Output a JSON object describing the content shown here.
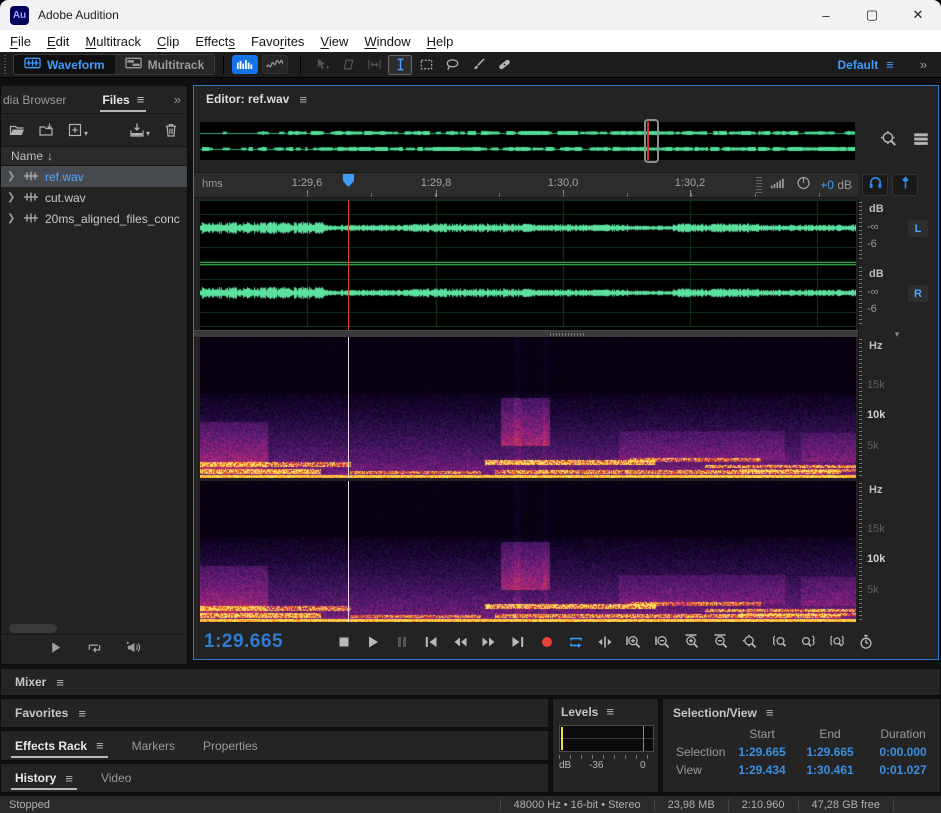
{
  "window": {
    "title": "Adobe Audition",
    "logo": "Au",
    "controls": {
      "minimize": "–",
      "maximize": "▢",
      "close": "✕"
    }
  },
  "menu_bar": {
    "items": [
      {
        "label": "File",
        "accel": 0
      },
      {
        "label": "Edit",
        "accel": 0
      },
      {
        "label": "Multitrack",
        "accel": 0
      },
      {
        "label": "Clip",
        "accel": 0
      },
      {
        "label": "Effects",
        "accel": 6
      },
      {
        "label": "Favorites",
        "accel": 4
      },
      {
        "label": "View",
        "accel": 0
      },
      {
        "label": "Window",
        "accel": 0
      },
      {
        "label": "Help",
        "accel": 0
      }
    ]
  },
  "toolbar": {
    "waveform_label": "Waveform",
    "multitrack_label": "Multitrack",
    "view_buttons": [
      {
        "name": "waveform-view",
        "active": true
      },
      {
        "name": "spectral-frequency-view",
        "active": false
      }
    ],
    "tools": [
      {
        "name": "move-tool",
        "state": "disabled"
      },
      {
        "name": "slip-tool",
        "state": "disabled"
      },
      {
        "name": "time-selection-tool",
        "state": "disabled"
      },
      {
        "name": "ibeam-tool",
        "state": "active"
      },
      {
        "name": "marquee-selection-tool",
        "state": "normal"
      },
      {
        "name": "lasso-selection-tool",
        "state": "normal"
      },
      {
        "name": "paintbrush-selection-tool",
        "state": "normal"
      },
      {
        "name": "spot-healing-brush-tool",
        "state": "normal"
      }
    ],
    "workspace_label": "Default",
    "overflow_chevron": "»"
  },
  "files_panel": {
    "tab_media_browser": "dia Browser",
    "tab_files": "Files",
    "overflow_chevron": "»",
    "toolbar_icons": [
      {
        "name": "open-file",
        "caret": false
      },
      {
        "name": "import-file",
        "caret": false
      },
      {
        "name": "new-content",
        "caret": true
      },
      {
        "name": "media-import",
        "caret": true
      },
      {
        "name": "delete",
        "caret": false
      }
    ],
    "column_header": "Name",
    "sort_arrow": "↓",
    "rows": [
      {
        "name": "ref.wav",
        "selected": true
      },
      {
        "name": "cut.wav",
        "selected": false
      },
      {
        "name": "20ms_aligned_files_conc",
        "selected": false
      }
    ],
    "preview_buttons": [
      {
        "name": "preview-play"
      },
      {
        "name": "preview-loop"
      },
      {
        "name": "preview-autoplay"
      }
    ]
  },
  "editor": {
    "title": "Editor: ref.wav",
    "ruler": {
      "unit": "hms",
      "ticks": [
        "1:29,6",
        "1:29,8",
        "1:30,0",
        "1:30,2"
      ],
      "gain_value": "+0",
      "gain_unit": "dB"
    },
    "waveform_scale": {
      "unit": "dB",
      "minus_inf": "-∞",
      "minus_six": "-6",
      "left_button": "L",
      "right_button": "R"
    },
    "spectral_scale": {
      "unit": "Hz",
      "tick_15k": "15k",
      "tick_10k": "10k",
      "tick_5k": "5k"
    },
    "collapse_arrow": "▾",
    "transport": {
      "time": "1:29.665",
      "buttons": [
        {
          "name": "stop",
          "state": "normal"
        },
        {
          "name": "play",
          "state": "normal"
        },
        {
          "name": "pause",
          "state": "disabled"
        },
        {
          "name": "skip-to-start",
          "state": "normal"
        },
        {
          "name": "rewind",
          "state": "normal"
        },
        {
          "name": "fast-forward",
          "state": "normal"
        },
        {
          "name": "skip-to-end",
          "state": "normal"
        },
        {
          "name": "record",
          "state": "record"
        },
        {
          "name": "loop-playback",
          "state": "blue"
        },
        {
          "name": "skip-selection",
          "state": "normal"
        },
        {
          "name": "zoom-in-amplitude",
          "state": "normal"
        },
        {
          "name": "zoom-out-amplitude",
          "state": "normal"
        },
        {
          "name": "zoom-in-time",
          "state": "normal"
        },
        {
          "name": "zoom-out-time",
          "state": "normal"
        },
        {
          "name": "zoom-reset",
          "state": "normal"
        },
        {
          "name": "zoom-to-in-point",
          "state": "normal"
        },
        {
          "name": "zoom-to-out-point",
          "state": "normal"
        },
        {
          "name": "zoom-to-selection",
          "state": "normal"
        },
        {
          "name": "timer-record",
          "state": "normal"
        }
      ]
    }
  },
  "mixer_panel": {
    "title": "Mixer"
  },
  "favorites_panel": {
    "title": "Favorites"
  },
  "effects_tabs": [
    {
      "label": "Effects Rack",
      "active": true
    },
    {
      "label": "Markers",
      "active": false
    },
    {
      "label": "Properties",
      "active": false
    }
  ],
  "history_tabs": [
    {
      "label": "History",
      "active": true
    },
    {
      "label": "Video",
      "active": false
    }
  ],
  "levels_panel": {
    "title": "Levels",
    "scale_db": "dB",
    "scale_minus36": "-36",
    "scale_zero": "0"
  },
  "selection_view_panel": {
    "title": "Selection/View",
    "columns": [
      "Start",
      "End",
      "Duration"
    ],
    "rows": [
      {
        "label": "Selection",
        "start": "1:29.665",
        "end": "1:29.665",
        "duration": "0:00.000"
      },
      {
        "label": "View",
        "start": "1:29.434",
        "end": "1:30.461",
        "duration": "0:01.027"
      }
    ]
  },
  "status_bar": {
    "state": "Stopped",
    "format_info": "48000 Hz • 16-bit • Stereo",
    "file_size": "23,98 MB",
    "total_duration": "2:10.960",
    "free_space": "47,28 GB free"
  },
  "colors": {
    "accent_blue": "#3f9bfa",
    "value_blue": "#3d8fe0",
    "wave_green": "#5ce0a0",
    "record_red": "#e8413c",
    "editor_border": "#2d78c8"
  }
}
